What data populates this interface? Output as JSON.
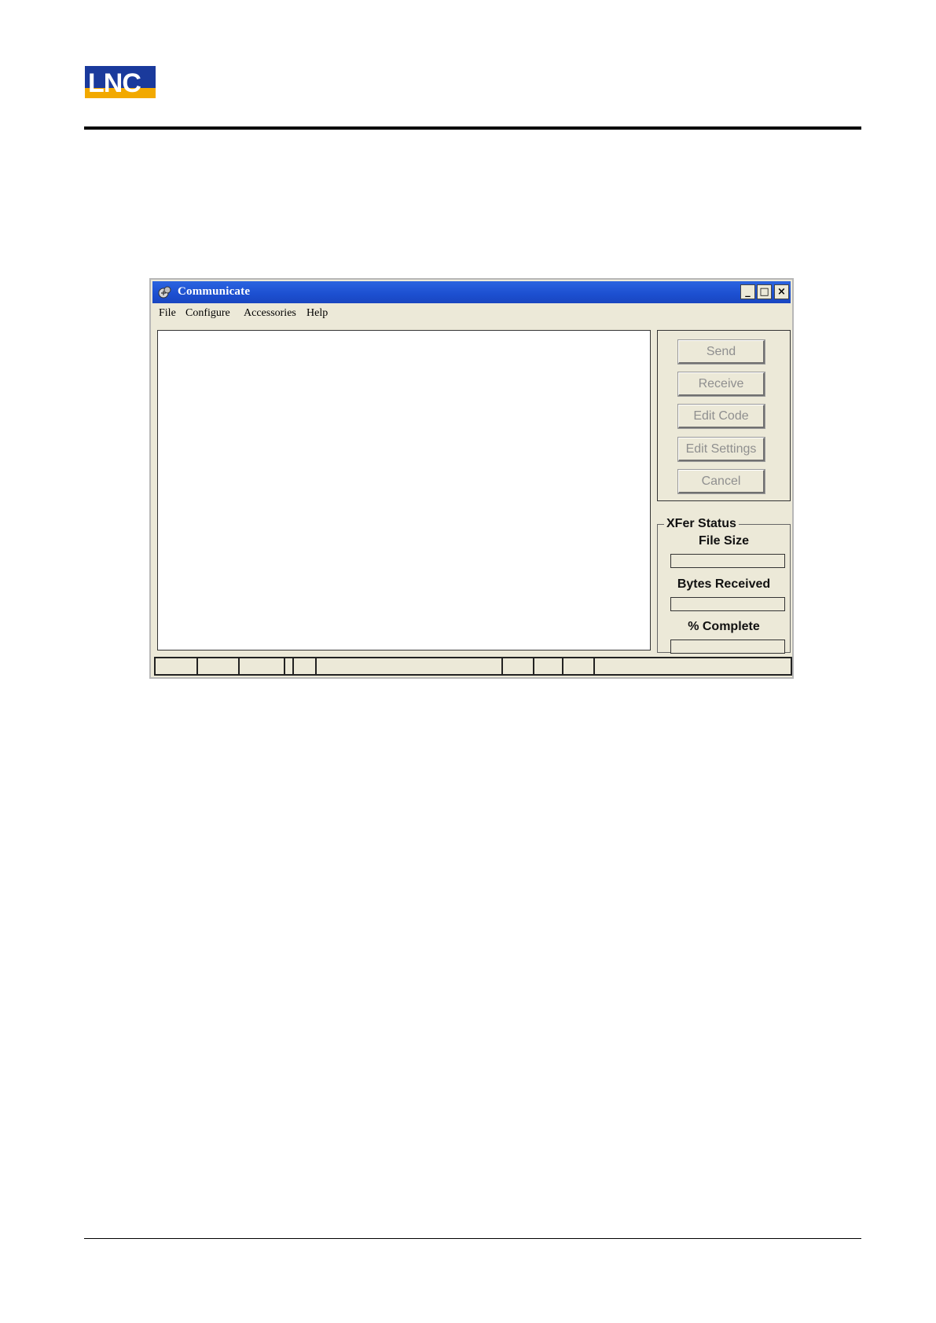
{
  "window": {
    "title": "Communicate",
    "controls": {
      "minimize": "_",
      "maximize": "□",
      "close": "×"
    }
  },
  "menu": {
    "items": [
      {
        "label": "File"
      },
      {
        "label": "Configure"
      },
      {
        "label": "Accessories"
      },
      {
        "label": "Help"
      }
    ]
  },
  "buttons": {
    "send": "Send",
    "receive": "Receive",
    "edit_code": "Edit Code",
    "edit_settings": "Edit Settings",
    "cancel": "Cancel"
  },
  "xfer_status": {
    "title": "XFer Status",
    "file_size_label": "File Size",
    "file_size_value": "",
    "bytes_received_label": "Bytes Received",
    "bytes_received_value": "",
    "percent_complete_label": "% Complete",
    "percent_complete_value": ""
  },
  "colors": {
    "titlebar": "#1c4fd0",
    "window_bg": "#ece9d8",
    "logo_blue": "#1a3a9c",
    "logo_yellow": "#f2a900"
  }
}
